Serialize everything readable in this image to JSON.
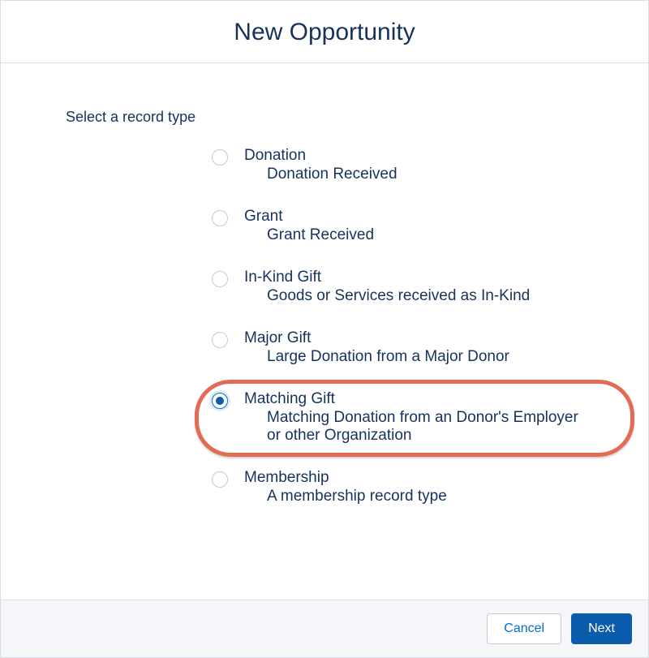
{
  "header": {
    "title": "New Opportunity"
  },
  "prompt": "Select a record type",
  "options": [
    {
      "label": "Donation",
      "desc": "Donation Received",
      "selected": false,
      "highlighted": false
    },
    {
      "label": "Grant",
      "desc": "Grant Received",
      "selected": false,
      "highlighted": false
    },
    {
      "label": "In-Kind Gift",
      "desc": "Goods or Services received as In-Kind",
      "selected": false,
      "highlighted": false
    },
    {
      "label": "Major Gift",
      "desc": "Large Donation from a Major Donor",
      "selected": false,
      "highlighted": false
    },
    {
      "label": "Matching Gift",
      "desc": "Matching Donation from an Donor's Employer or other Organization",
      "selected": true,
      "highlighted": true
    },
    {
      "label": "Membership",
      "desc": "A membership record type",
      "selected": false,
      "highlighted": false
    }
  ],
  "footer": {
    "cancel": "Cancel",
    "next": "Next"
  },
  "colors": {
    "highlight_ring": "#e36a55",
    "brand": "#0b5cab",
    "link": "#0070d2"
  }
}
